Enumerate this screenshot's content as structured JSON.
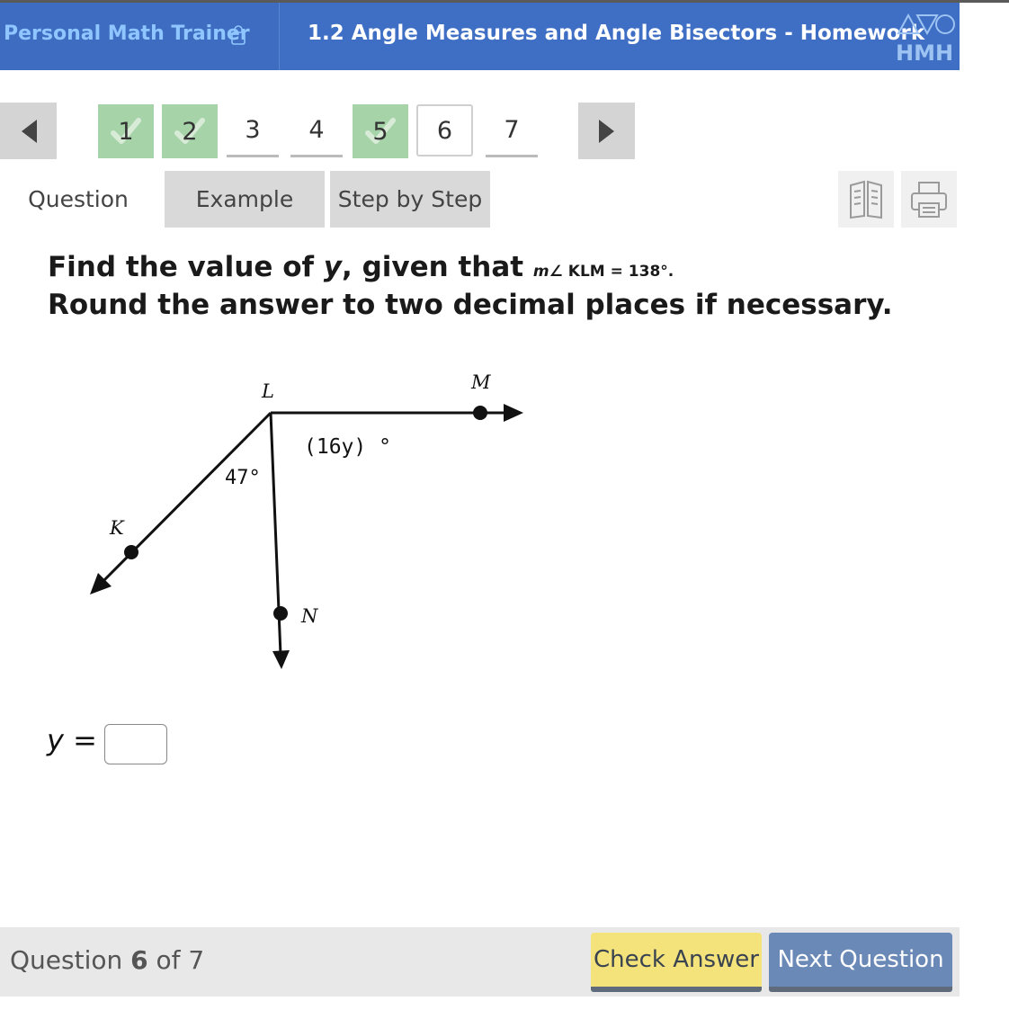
{
  "header": {
    "app_title": "Personal Math Trainer",
    "lesson_title": "1.2 Angle Measures and Angle Bisectors - Homework",
    "logo_text": "HMH"
  },
  "nav": {
    "questions": [
      {
        "label": "1",
        "status": "completed"
      },
      {
        "label": "2",
        "status": "completed"
      },
      {
        "label": "3",
        "status": "unanswered"
      },
      {
        "label": "4",
        "status": "unanswered"
      },
      {
        "label": "5",
        "status": "completed"
      },
      {
        "label": "6",
        "status": "current"
      },
      {
        "label": "7",
        "status": "unanswered"
      }
    ]
  },
  "tabs": {
    "question": "Question",
    "example": "Example",
    "step_by_step": "Step by Step"
  },
  "question": {
    "line1_prefix": "Find the value of ",
    "line1_var": "y",
    "line1_mid": ", given that ",
    "given_m": "m",
    "given_angle": "∠ KLM = 138°.",
    "line2": "Round the answer to two decimal places if necessary."
  },
  "diagram": {
    "label_L": "L",
    "label_M": "M",
    "label_K": "K",
    "label_N": "N",
    "angle_LMN": "(16y) °",
    "angle_KLN": "47°"
  },
  "answer": {
    "variable": "y",
    "equals": " =",
    "value": ""
  },
  "footer": {
    "question_word": "Question",
    "current": "6",
    "of_total": "of 7",
    "check_answer": "Check Answer",
    "next_question": "Next Question"
  },
  "colors": {
    "header_bg": "#3f6fc4",
    "completed_green": "#a6d3a8",
    "check_button": "#f4e27a",
    "next_button": "#6b89b7"
  }
}
